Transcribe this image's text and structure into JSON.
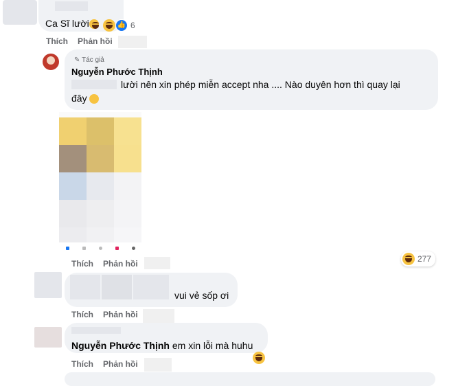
{
  "comments": [
    {
      "text": "Ca Sĩ lười",
      "reaction_count": "6",
      "actions": {
        "like": "Thích",
        "reply": "Phản hồi"
      }
    },
    {
      "author_badge": "Tác giả",
      "author": "Nguyễn Phước Thịnh",
      "text_line1": "lười nên xin phép miễn accept nha .... Nào duyên hơn thì quay lại",
      "text_line2": "đây",
      "reaction_count": "277",
      "actions": {
        "like": "Thích",
        "reply": "Phản hồi"
      }
    },
    {
      "text": "vui vẻ sốp ơi",
      "actions": {
        "like": "Thích",
        "reply": "Phản hồi"
      }
    },
    {
      "author": "Nguyễn Phước Thịnh",
      "text": "em xin lỗi mà huhu",
      "actions": {
        "like": "Thích",
        "reply": "Phản hồi"
      }
    }
  ],
  "colors": {
    "bubble": "#f0f2f5",
    "meta": "#65676b",
    "accent": "#1877f2"
  }
}
